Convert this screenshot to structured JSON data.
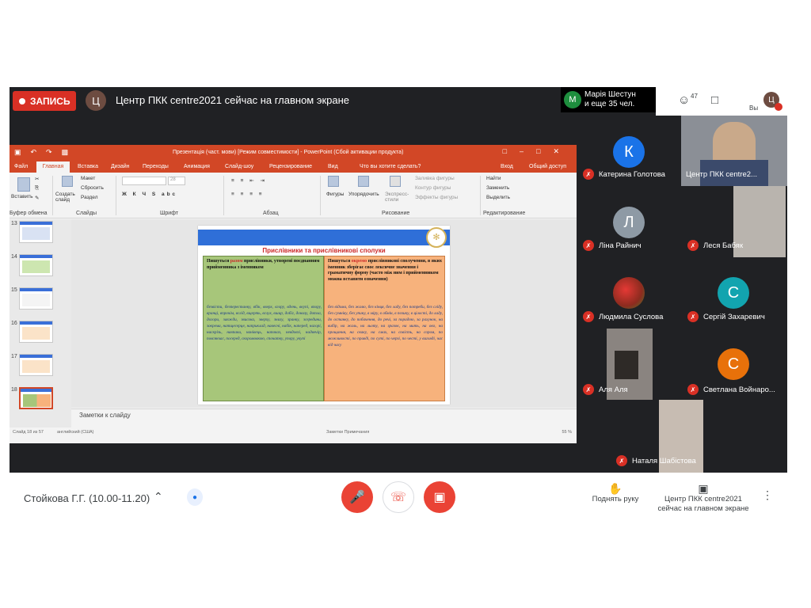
{
  "meet": {
    "record_label": "ЗАПИСЬ",
    "presenter_avatar": "Ц",
    "presenter_text": "Центр ПКК centre2021 сейчас на главном экране",
    "pinned_avatar": "М",
    "pinned_name_1": "Марія Шестун",
    "pinned_name_2": "и еще 35 чел.",
    "people_count": "47",
    "you_label": "Вы",
    "you_avatar": "Ц"
  },
  "ppt": {
    "window_title": "Презентація (част. мови) [Режим совместимости] - PowerPoint (Сбой активации продукта)",
    "tabs": [
      "Файл",
      "Главная",
      "Вставка",
      "Дизайн",
      "Переходы",
      "Анимация",
      "Слайд-шоу",
      "Рецензирование",
      "Вид",
      "Что вы хотите сделать?",
      "Вход",
      "Общий доступ"
    ],
    "ribbon": {
      "paste": "Вставить",
      "new_slide": "Создать слайд",
      "layout": "Макет",
      "reset": "Сбросить",
      "section": "Раздел",
      "shapes": "Фигуры",
      "arrange": "Упорядочить",
      "quick_styles": "Экспресс-стили",
      "shape_fill": "Заливка фигуры",
      "shape_outline": "Контур фигуры",
      "shape_effects": "Эффекты фигуры",
      "find": "Найти",
      "replace": "Заменить",
      "select": "Выделить",
      "font_size": "28",
      "groups": [
        "Буфер обмена",
        "Слайды",
        "Шрифт",
        "Абзац",
        "Рисование",
        "Редактирование"
      ]
    },
    "thumb_numbers": [
      "13",
      "14",
      "15",
      "16",
      "17",
      "18"
    ],
    "notes": "Заметки к слайду",
    "status_left": "Слайд 18 из 57",
    "status_lang": "английский (США)",
    "status_notes": "Заметки   Примечания",
    "status_zoom": "55 %"
  },
  "slide": {
    "title": "Прислівники та прислівникові сполуки",
    "left_head_1": "Пишуться",
    "left_head_hl": "разом",
    "left_head_2": "прислівники, утворені поєднанням прийменника з іменником",
    "left_body": "безвісти, безперестанку, вбік, вверх, вгору, вдень, вкупі, впору, вранці, впрочім, вслід, вщерть, вслух, вшир, добіг, донизу, дотла, догори, завжди, звисока, зверху, знизу, зранку, зсередини, зокрема, натщесерце, наприклад, навесні, набік, наперед, нагорі, наскрізь, навпаки, нанівець, напоказ, невдовзі, надвечір, повсякчас, посеред, скоромовкою, спочатку, упору, укупі",
    "right_head_1": "Пишуться",
    "right_head_hl": "окремо",
    "right_head_2": "прислівникові сполучення, в яких іменник зберігає своє лексичне значення і граматичну форму (часто між ним і прийменником можна вставити означення)",
    "right_body": "без відома, без жалю, без кінця, без ладу, без потреби, без сліду, без сумніву, без упину, в міру, в обмін, в позику, в цілості, до ладу, до останку, до побачення, до речі, за порадою, за рахунок, на вибір, на жаль, на льоту, на зразок, на мить, на око, на прощання, на скаку, на смах, на совість, на сором, по можливості, по правді, по суті, по черзі, по честі, у вигляді, час від часу"
  },
  "participants": [
    {
      "avatar": "К",
      "name": "Катерина Голотова",
      "color": "#1a73e8"
    },
    {
      "name": "Центр ПКК centre2..."
    },
    {
      "avatar": "Л",
      "name": "Ліна Райнич",
      "color": "#8e9aa5"
    },
    {
      "name": "Леся Бабяк"
    },
    {
      "name": "Людмила Суслова"
    },
    {
      "avatar": "С",
      "name": "Сергій Захаревич",
      "color": "#12a4af"
    },
    {
      "name": "Аля Аля"
    },
    {
      "avatar": "С",
      "name": "Светлана Войнаро...",
      "color": "#e8710a"
    },
    {
      "name": "Наталя Шабістова"
    }
  ],
  "bottom": {
    "meeting_name": "Стойкова Г.Г. (10.00-11.20)",
    "raise_hand": "Поднять руку",
    "presenting_1": "Центр ПКК centre2021",
    "presenting_2": "сейчас на главном экране"
  },
  "colors": {
    "record": "#d93025",
    "ppt_accent": "#d24726",
    "end_call": "#ea4335"
  }
}
